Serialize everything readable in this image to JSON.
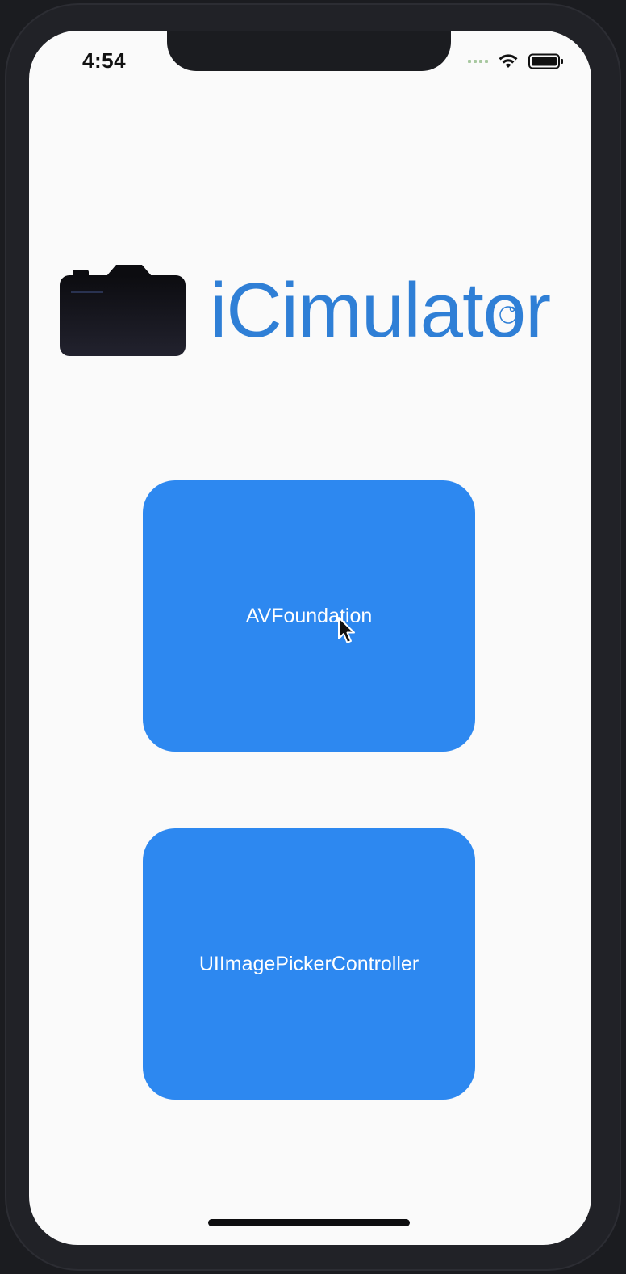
{
  "status_bar": {
    "time": "4:54"
  },
  "app": {
    "logo_text": "iCimulator",
    "brand_color": "#2f7fd6",
    "button_color": "#2d88f0"
  },
  "buttons": [
    {
      "label": "AVFoundation"
    },
    {
      "label": "UIImagePickerController"
    }
  ],
  "icons": {
    "camera": "camera-icon",
    "wifi": "wifi-icon",
    "battery": "battery-icon",
    "cursor": "mouse-cursor-icon"
  }
}
